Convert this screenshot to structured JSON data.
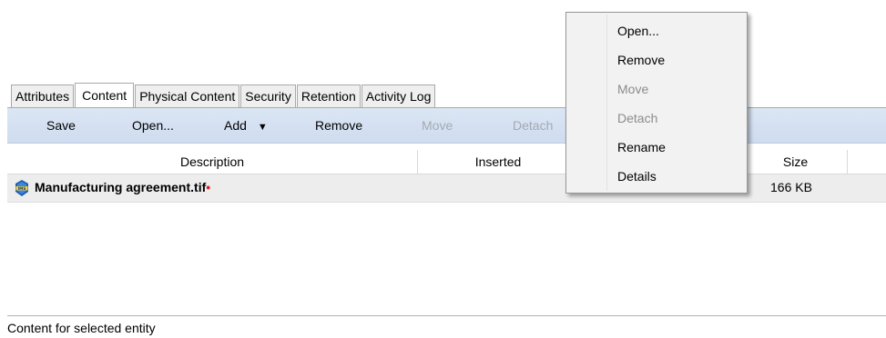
{
  "tabs": [
    {
      "label": "Attributes",
      "active": false
    },
    {
      "label": "Content",
      "active": true
    },
    {
      "label": "Physical Content",
      "active": false
    },
    {
      "label": "Security",
      "active": false
    },
    {
      "label": "Retention",
      "active": false
    },
    {
      "label": "Activity Log",
      "active": false
    }
  ],
  "toolbar": {
    "save": "Save",
    "open": "Open...",
    "add": "Add",
    "add_arrow": "▼",
    "remove": "Remove",
    "move": "Move",
    "detach": "Detach"
  },
  "columns": {
    "description": "Description",
    "inserted": "Inserted",
    "size": "Size"
  },
  "rows": [
    {
      "name": "Manufacturing agreement.tif",
      "marker": "•",
      "size": "166 KB",
      "icon": "ims-file-icon"
    }
  ],
  "status": "Content for selected entity",
  "context_menu": {
    "items": [
      {
        "label": "Open...",
        "enabled": true
      },
      {
        "label": "Remove",
        "enabled": true
      },
      {
        "label": "Move",
        "enabled": false
      },
      {
        "label": "Detach",
        "enabled": false
      },
      {
        "label": "Rename",
        "enabled": true
      },
      {
        "label": "Details",
        "enabled": true
      }
    ]
  },
  "colors": {
    "toolbar_bg": "#d6e2f2",
    "row_bg": "#ededed",
    "disabled_text": "#a3a9b3",
    "marker": "#e02020"
  }
}
